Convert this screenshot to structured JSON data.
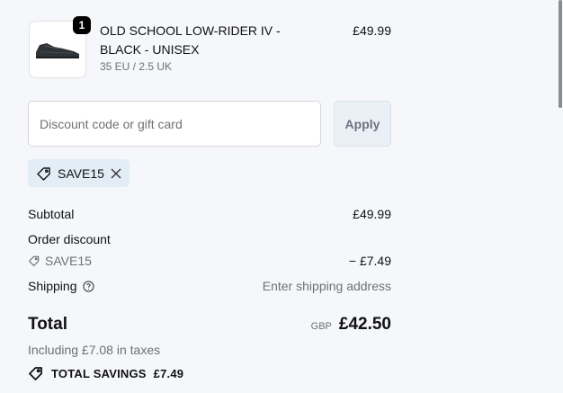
{
  "cart_item": {
    "quantity": "1",
    "name": "OLD SCHOOL LOW-RIDER IV - BLACK - UNISEX",
    "variant": "35 EU / 2.5 UK",
    "price": "£49.99",
    "image_icon": "sneaker-icon"
  },
  "discount": {
    "placeholder": "Discount code or gift card",
    "value": "",
    "apply_label": "Apply",
    "applied_code": "SAVE15"
  },
  "summary": {
    "subtotal_label": "Subtotal",
    "subtotal_value": "£49.99",
    "order_discount_label": "Order discount",
    "discount_code": "SAVE15",
    "discount_value": "− £7.49",
    "shipping_label": "Shipping",
    "shipping_value": "Enter shipping address",
    "total_label": "Total",
    "currency": "GBP",
    "total_value": "£42.50",
    "taxes_note": "Including £7.08 in taxes",
    "savings_label": "TOTAL SAVINGS",
    "savings_value": "£7.49"
  },
  "colors": {
    "background": "#f5f7fa",
    "chip_background": "#e3edf6",
    "muted_text": "#707070"
  }
}
